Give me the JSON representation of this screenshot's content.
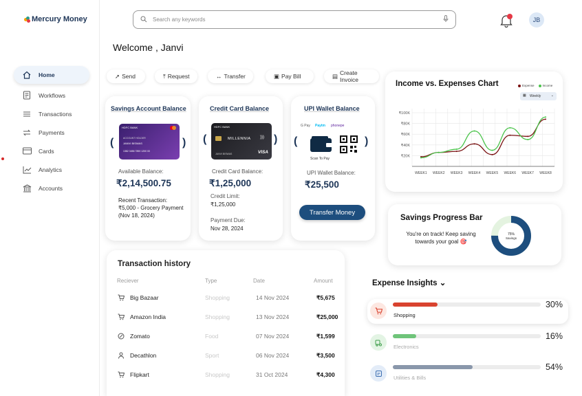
{
  "app": {
    "name": "Mercury Money"
  },
  "sidebar": {
    "items": [
      {
        "label": "Home",
        "icon": "home-icon",
        "active": true
      },
      {
        "label": "Workflows",
        "icon": "document-icon"
      },
      {
        "label": "Transactions",
        "icon": "list-icon"
      },
      {
        "label": "Payments",
        "icon": "swap-icon"
      },
      {
        "label": "Cards",
        "icon": "card-icon"
      },
      {
        "label": "Analytics",
        "icon": "chart-icon"
      },
      {
        "label": "Accounts",
        "icon": "bank-icon"
      }
    ]
  },
  "header": {
    "search_placeholder": "Search any keywords",
    "avatar_initials": "JB",
    "notification_color": "#e63946"
  },
  "welcome": "Welcome , Janvi",
  "quick_actions": [
    {
      "label": "Send",
      "glyph": "➚"
    },
    {
      "label": "Request",
      "glyph": "⤒"
    },
    {
      "label": "Transfer",
      "glyph": "↔"
    },
    {
      "label": "Pay Bill",
      "glyph": "▣"
    },
    {
      "label": "Create Invoice",
      "glyph": "▤"
    }
  ],
  "savings_card": {
    "title": "Savings Account Balance",
    "card_bank": "HDFC BANK",
    "card_holder_label": "ACCOUNT HOLDER",
    "card_holder": "JANVI BISWAS",
    "card_number": "1382 3456 7890 1200 00",
    "available_label": "Available Balance:",
    "available_amount": "₹2,14,500.75",
    "recent_label": "Recent Transaction:",
    "recent_line1": "₹5,000 - Grocery Payment",
    "recent_line2": "(Nov 18, 2024)"
  },
  "credit_card": {
    "title": "Credit Card Balance",
    "card_bank": "HDFC BANK",
    "card_name": "MILLENNIA",
    "card_network": "VISA",
    "card_holder": "JANVI BISWAS",
    "balance_label": "Credit Card Balance:",
    "balance_amount": "₹1,25,000",
    "limit_label": "Credit Limit:",
    "limit_amount": "₹1,25,000",
    "due_label": "Payment Due:",
    "due_date": "Nov 28, 2024"
  },
  "upi_card": {
    "title": "UPI Wallet Balance",
    "apps": [
      "G Pay",
      "Paytm",
      "phonepe"
    ],
    "scan_label": "Scan To Pay",
    "balance_label": "UPI Wallet Balance:",
    "balance_amount": "₹25,500",
    "button_label": "Transfer Money"
  },
  "transactions": {
    "title": "Transaction history",
    "headers": [
      "Reciever",
      "Type",
      "Date",
      "Amount"
    ],
    "rows": [
      {
        "name": "Big Bazaar",
        "type": "Shopping",
        "date": "14 Nov 2024",
        "amount": "₹5,675",
        "icon": "cart-icon"
      },
      {
        "name": "Amazon India",
        "type": "Shopping",
        "date": "13 Nov 2024",
        "amount": "₹25,000",
        "icon": "cart-icon"
      },
      {
        "name": "Zomato",
        "type": "Food",
        "date": "07 Nov 2024",
        "amount": "₹1,599",
        "icon": "food-icon"
      },
      {
        "name": "Decathlon",
        "type": "Sport",
        "date": "06 Nov 2024",
        "amount": "₹3,500",
        "icon": "person-icon"
      },
      {
        "name": "Flipkart",
        "type": "Shopping",
        "date": "31 Oct 2024",
        "amount": "₹4,300",
        "icon": "cart-icon"
      }
    ]
  },
  "income_chart": {
    "title": "Income vs. Expenses Chart",
    "legend": [
      "Expense",
      "Income"
    ],
    "period": "Weekly"
  },
  "chart_data": {
    "type": "line",
    "title": "Income vs. Expenses Chart",
    "categories": [
      "WEEK1",
      "WEEK2",
      "WEEK3",
      "WEEK4",
      "WEEK5",
      "WEEK6",
      "WEEK7",
      "WEEK8"
    ],
    "y_ticks": [
      "₹100K",
      "₹80K",
      "₹60K",
      "₹40K",
      "₹20K"
    ],
    "ylim": [
      0,
      100
    ],
    "series": [
      {
        "name": "Expense",
        "color": "#7a1212",
        "values": [
          18,
          26,
          28,
          42,
          22,
          58,
          56,
          88
        ]
      },
      {
        "name": "Income",
        "color": "#4cc44c",
        "values": [
          16,
          26,
          32,
          66,
          30,
          72,
          50,
          92
        ]
      }
    ],
    "grid": true,
    "legend": "top-right"
  },
  "savings": {
    "title": "Savings Progress Bar",
    "message": "You're on track! Keep saving towards your goal 🎯",
    "percent": 75,
    "percent_label": "75%",
    "donut_label": "Savings"
  },
  "expenses": {
    "title": "Expense Insights",
    "items": [
      {
        "label": "Shopping",
        "percent": 30,
        "percent_label": "30%",
        "color": "#d9432f",
        "icon_bg": "#fde7e1",
        "icon_color": "#d9432f"
      },
      {
        "label": "Electronics",
        "percent": 16,
        "percent_label": "16%",
        "color": "#6fc47a",
        "icon_bg": "#e3f4e4",
        "icon_color": "#3f9e4b"
      },
      {
        "label": "Utilities & Bills",
        "percent": 54,
        "percent_label": "54%",
        "color": "#8a97ab",
        "icon_bg": "#e3ecf8",
        "icon_color": "#3a6db0"
      }
    ]
  }
}
